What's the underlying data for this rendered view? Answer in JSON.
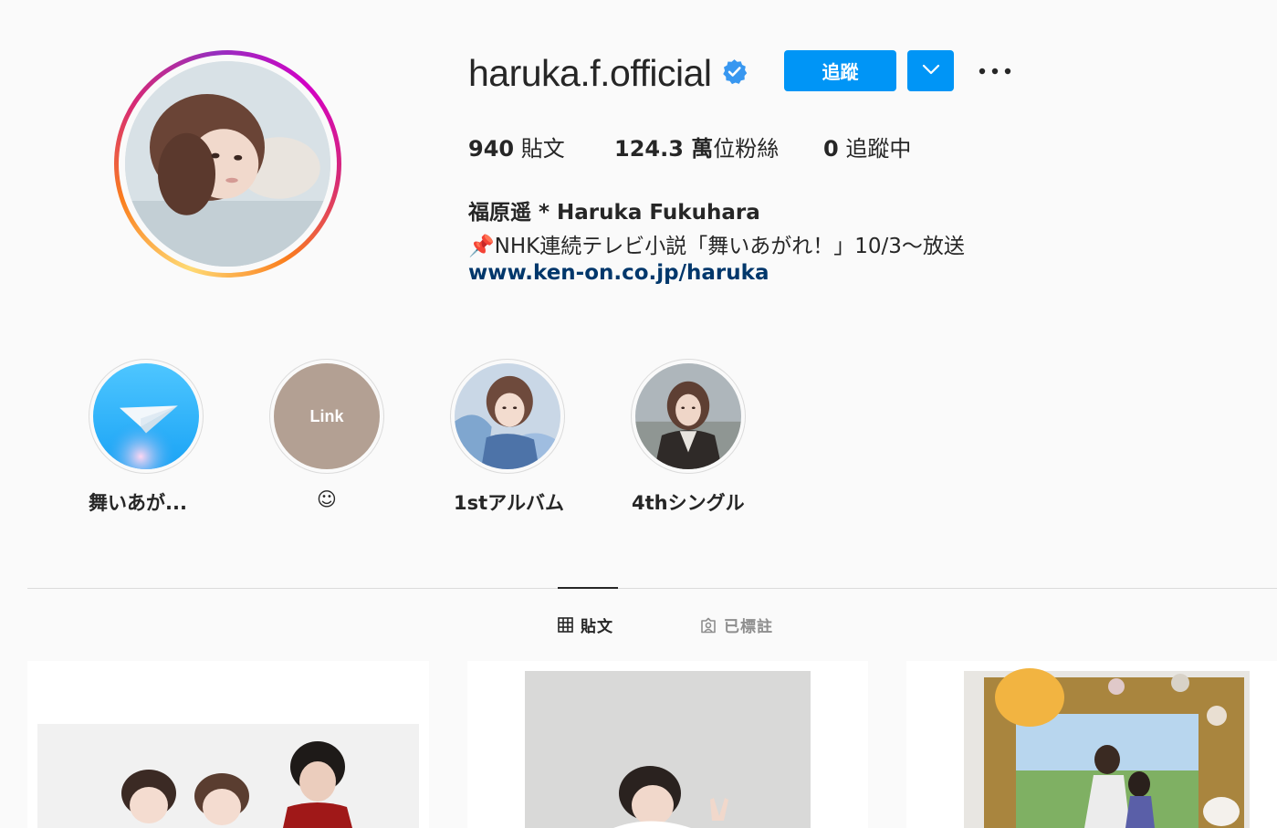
{
  "profile": {
    "username": "haruka.f.official",
    "follow_label": "追蹤",
    "posts_count": "940",
    "posts_label": "貼文",
    "followers_count": "124.3 萬",
    "followers_label": "位粉絲",
    "following_count": "0",
    "following_label": "追蹤中",
    "full_name": "福原遥 * Haruka Fukuhara",
    "bio_emoji": "📌",
    "bio_text": "NHK連続テレビ小説「舞いあがれ！」10/3〜放送",
    "website": "www.ken-on.co.jp/haruka"
  },
  "highlights": [
    {
      "label": "舞いあが..."
    },
    {
      "label": "☺",
      "cover_text": "Link"
    },
    {
      "label": "1stアルバム"
    },
    {
      "label": "4thシングル"
    }
  ],
  "tabs": [
    {
      "label": "貼文",
      "icon": "grid-icon",
      "active": true
    },
    {
      "label": "已標註",
      "icon": "tagged-icon",
      "active": false
    }
  ],
  "colors": {
    "accent": "#0095f6",
    "link": "#00376b",
    "background": "#fafafa",
    "verified": "#3897f0"
  }
}
